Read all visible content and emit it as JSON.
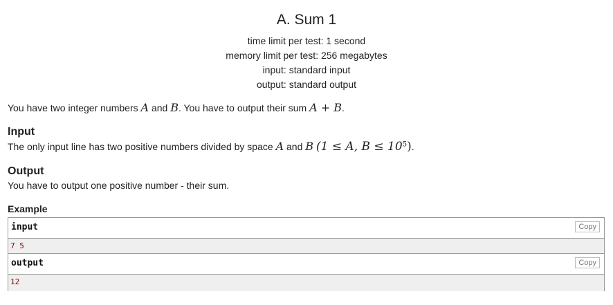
{
  "problem": {
    "title": "A. Sum 1",
    "time_limit": "time limit per test: 1 second",
    "memory_limit": "memory limit per test: 256 megabytes",
    "input": "input: standard input",
    "output": "output: standard output"
  },
  "legend": {
    "t1": "You have two integer numbers ",
    "m1": "A",
    "t2": " and ",
    "m2": "B",
    "t3": ". You have to output their sum ",
    "m3": "A + B",
    "t4": "."
  },
  "input_section": {
    "title": "Input",
    "t1": "The only input line has two positive numbers divided by space ",
    "m1": "A",
    "t2": " and ",
    "m2": "B",
    "m3": "(1 ≤ A, B ≤ 10",
    "sup": "5",
    "m4": ")",
    "t3": "."
  },
  "output_section": {
    "title": "Output",
    "text": "You have to output one positive number - their sum."
  },
  "example": {
    "title": "Example",
    "input_label": "input",
    "input_value": "7 5",
    "output_label": "output",
    "output_value": "12",
    "copy_label": "Copy"
  }
}
